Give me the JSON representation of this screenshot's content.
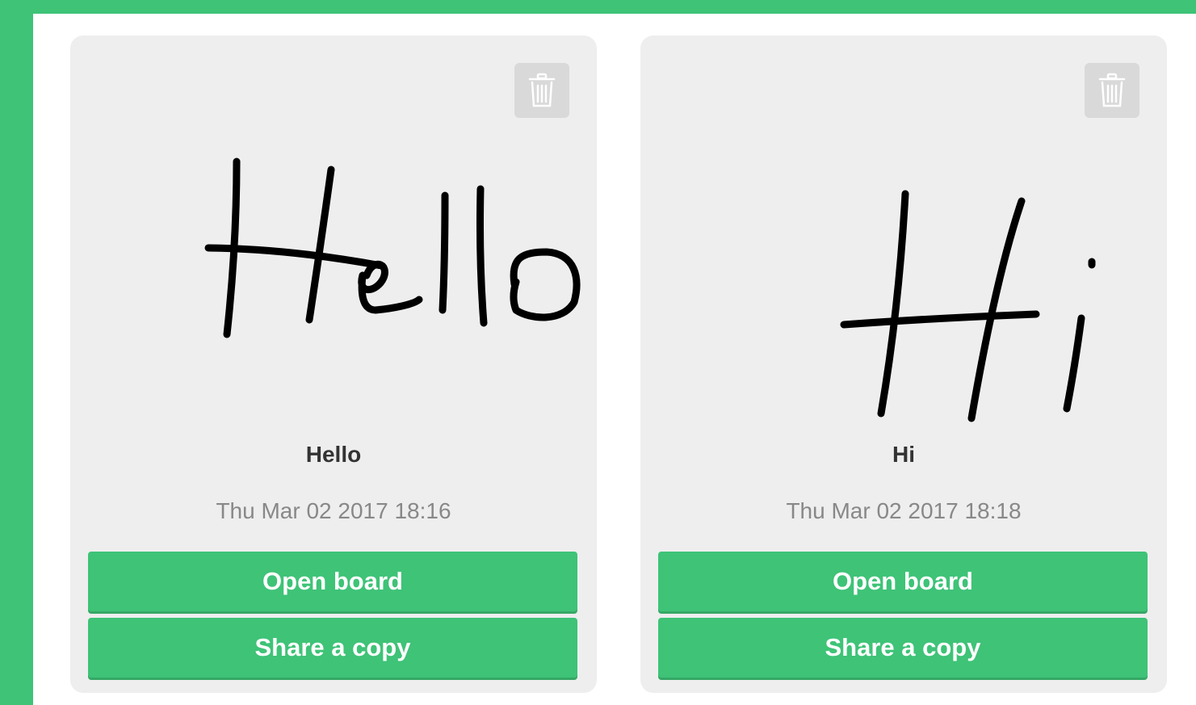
{
  "colors": {
    "brand": "#3ec377",
    "card": "#eeeeee",
    "ink": "#000000",
    "title": "#333333",
    "date": "#888888"
  },
  "boards": [
    {
      "title": "Hello",
      "date": "Thu Mar 02 2017 18:16",
      "open_label": "Open board",
      "share_label": "Share a copy",
      "delete_icon": "trash-icon",
      "thumbnail": "handwritten-sketch"
    },
    {
      "title": "Hi",
      "date": "Thu Mar 02 2017 18:18",
      "open_label": "Open board",
      "share_label": "Share a copy",
      "delete_icon": "trash-icon",
      "thumbnail": "handwritten-sketch"
    }
  ]
}
